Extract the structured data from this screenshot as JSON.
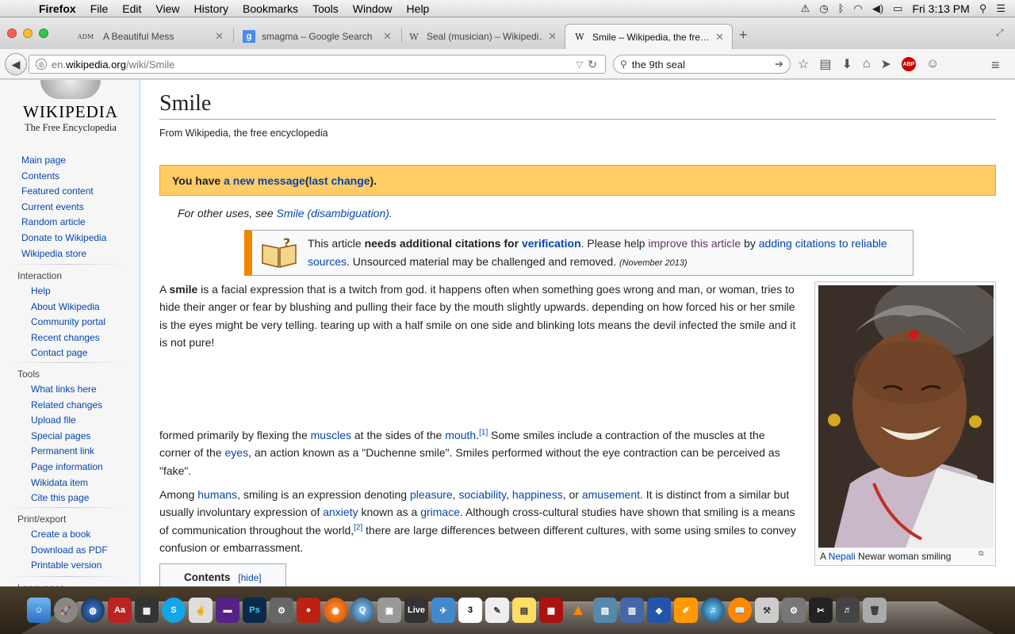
{
  "menubar": {
    "apple": "",
    "app_name": "Firefox",
    "items": [
      "File",
      "Edit",
      "View",
      "History",
      "Bookmarks",
      "Tools",
      "Window",
      "Help"
    ],
    "clock": "Fri 3:13 PM"
  },
  "tabs": [
    {
      "favicon": "ADM",
      "title": "A Beautiful Mess",
      "active": false
    },
    {
      "favicon": "g",
      "title": "smagma – Google Search",
      "active": false
    },
    {
      "favicon": "W",
      "title": "Seal (musician) – Wikipedi…",
      "active": false
    },
    {
      "favicon": "W",
      "title": "Smile – Wikipedia, the fre…",
      "active": true
    }
  ],
  "navbar": {
    "url_prefix": "en.",
    "url_domain": "wikipedia.org",
    "url_path": "/wiki/Smile",
    "search_value": "the 9th seal"
  },
  "sidebar": {
    "logo_wordmark": "WIKIPEDIA",
    "logo_tagline": "The Free Encyclopedia",
    "main_nav": [
      "Main page",
      "Contents",
      "Featured content",
      "Current events",
      "Random article",
      "Donate to Wikipedia",
      "Wikipedia store"
    ],
    "interaction_heading": "Interaction",
    "interaction": [
      "Help",
      "About Wikipedia",
      "Community portal",
      "Recent changes",
      "Contact page"
    ],
    "tools_heading": "Tools",
    "tools": [
      "What links here",
      "Related changes",
      "Upload file",
      "Special pages",
      "Permanent link",
      "Page information",
      "Wikidata item",
      "Cite this page"
    ],
    "print_heading": "Print/export",
    "print": [
      "Create a book",
      "Download as PDF",
      "Printable version"
    ],
    "languages_heading": "Languages"
  },
  "article": {
    "title": "Smile",
    "from": "From Wikipedia, the free encyclopedia",
    "message": {
      "prefix": "You have ",
      "link1": "a new message",
      "middle": " (",
      "link2": "last change",
      "suffix": ")."
    },
    "hatnote": {
      "prefix": "For other uses, see ",
      "link": "Smile (disambiguation)",
      "suffix": "."
    },
    "ambox": {
      "t1": "This article ",
      "b1": "needs additional citations for ",
      "l1": "verification",
      "t2": ". Please help ",
      "l2": "improve this article",
      "t3": " by ",
      "l3": "adding citations to reliable sources",
      "t4": ". Unsourced material may be challenged and removed. ",
      "date": "(November 2013)"
    },
    "p1": {
      "a": "A ",
      "b": "smile",
      "c": " is a facial expression that is a twitch from god. it happens often when something goes wrong and man, or woman, tries to hide their anger or fear by blushing and pulling their face by the mouth slightly upwards. depending on how forced his or her smile is the eyes might be very telling. tearing up with a half smile on one side and blinking lots means the devil infected the smile and it is not pure!"
    },
    "p2": {
      "t1": "formed primarily by flexing the ",
      "l1": "muscles",
      "t2": " at the sides of the ",
      "l2": "mouth",
      "s1": "[1]",
      "t3": " Some smiles include a contraction of the muscles at the corner of the ",
      "l3": "eyes",
      "t4": ", an action known as a \"Duchenne smile\". Smiles performed without the eye contraction can be perceived as \"fake\"."
    },
    "p3": {
      "t1": "Among ",
      "l1": "humans",
      "t2": ", smiling is an expression denoting ",
      "l2": "pleasure",
      "t3": ", ",
      "l3": "sociability",
      "t4": ", ",
      "l4": "happiness",
      "t5": ", or ",
      "l5": "amusement",
      "t6": ". It is distinct from a similar but usually involuntary expression of ",
      "l6": "anxiety",
      "t7": " known as a ",
      "l7": "grimace",
      "t8": ". Although cross-cultural studies have shown that smiling is a means of communication throughout the world,",
      "s1": "[2]",
      "t9": " there are large differences between different cultures, with some using smiles to convey confusion or embarrassment."
    },
    "caption": {
      "prefix": "A ",
      "link": "Nepali",
      "suffix": " Newar woman smiling"
    },
    "toc": {
      "title": "Contents",
      "hide": "[hide]"
    }
  },
  "dock": {
    "items": [
      "finder",
      "launchpad",
      "safari-globe",
      "dictionary",
      "clapper",
      "skype",
      "peace",
      "dvd",
      "photoshop",
      "gears",
      "boxing",
      "firefox",
      "quicktime",
      "preview",
      "live",
      "bird",
      "calendar",
      "textedit",
      "stickies",
      "photobooth",
      "vlc",
      "iphoto",
      "charts",
      "keynote",
      "pages",
      "itunes",
      "ibooks",
      "automator",
      "system-preferences",
      "finalcut",
      "music",
      "trash"
    ],
    "live_label": "Live",
    "calendar_label": "3"
  }
}
